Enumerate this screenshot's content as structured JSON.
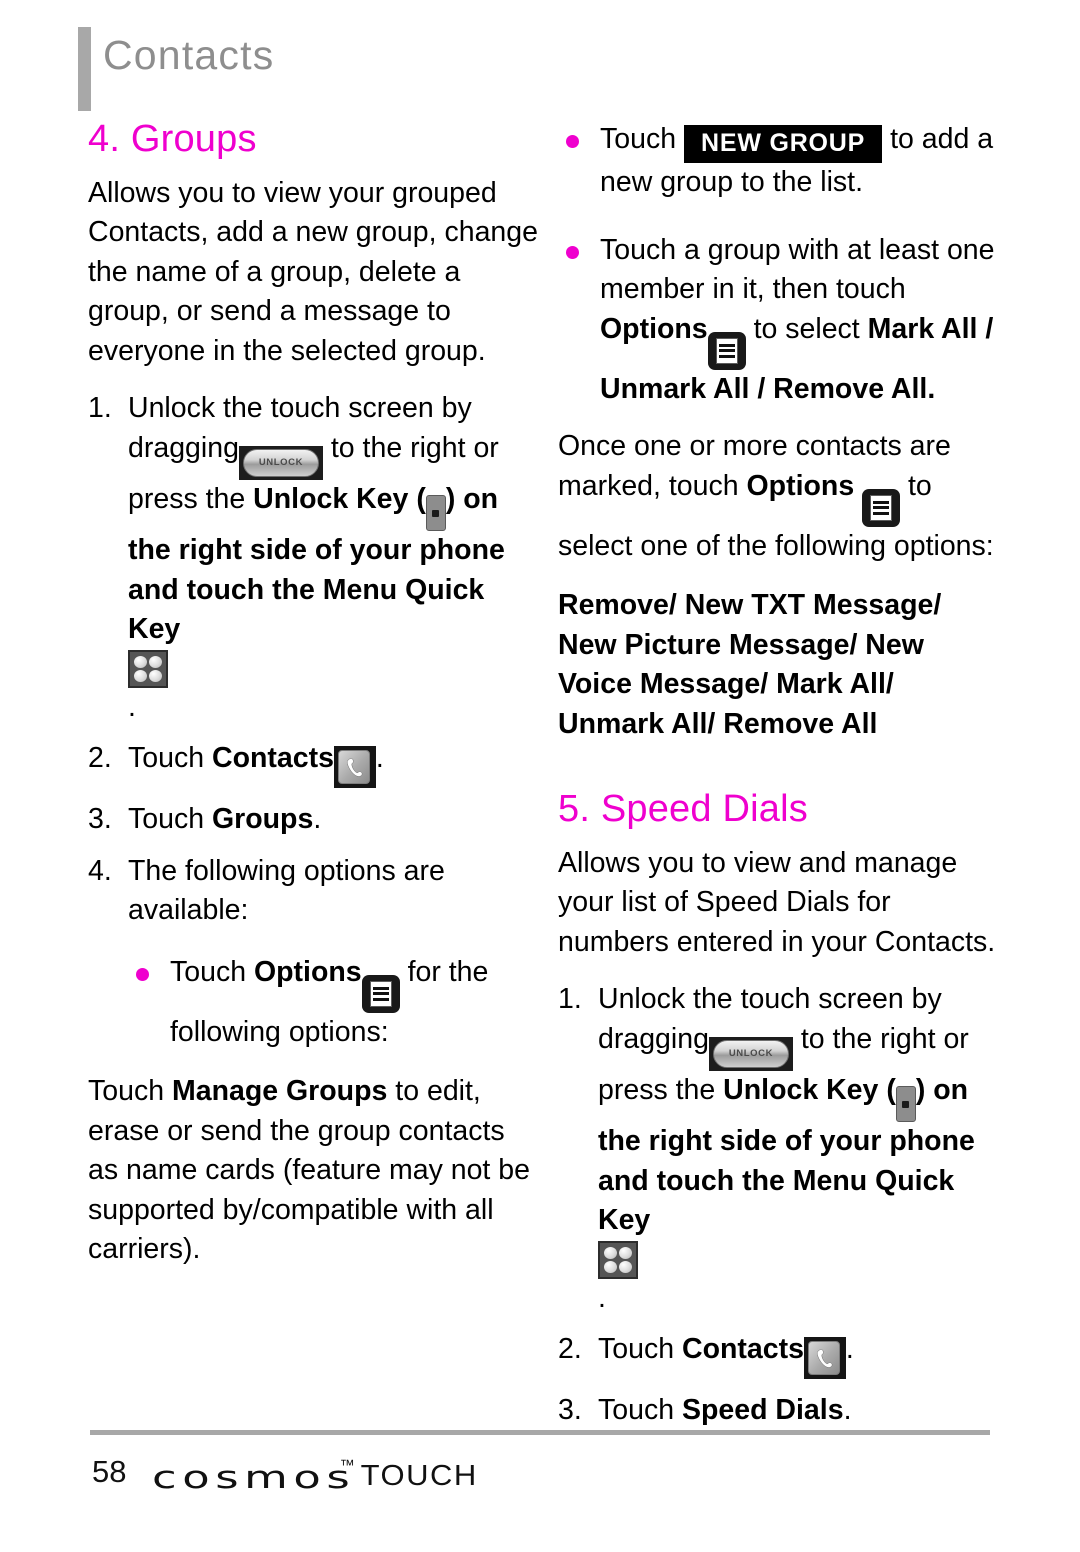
{
  "header": {
    "title": "Contacts"
  },
  "left_column": {
    "heading": "4. Groups",
    "intro": "Allows you to view your grouped Contacts, add a new group, change the name of a group, delete a group, or send a message to everyone in the selected group.",
    "steps": [
      {
        "num": "1.",
        "text_1": "Unlock the touch screen by dragging",
        "icon_1": "unlock-slider-icon",
        "text_2": "to the right or press the",
        "bold_1": "Unlock Key",
        "paren_open": "(",
        "icon_2": "side-unlock-key-icon",
        "paren_close": ")",
        "text_3": "on the right side of your phone and touch the",
        "bold_2": "Menu Quick Key",
        "icon_3": "menu-quick-key-icon",
        "text_4": "."
      },
      {
        "num": "2.",
        "text_1": "Touch",
        "bold_1": "Contacts",
        "icon_1": "contacts-icon",
        "text_2": "."
      },
      {
        "num": "3.",
        "text_1": "Touch",
        "bold_1": "Groups",
        "text_2": "."
      },
      {
        "num": "4.",
        "text_1": "The following options are available:"
      }
    ],
    "bullet_options": {
      "text_1": "Touch",
      "bold_1": "Options",
      "icon_1": "options-icon",
      "text_2": "for the following options:"
    },
    "manage_groups": {
      "text_1": "Touch",
      "bold_1": "Manage Groups",
      "text_2": "to edit, erase or send the group contacts as name cards (feature may not be supported by/compatible with all carriers)."
    }
  },
  "right_column": {
    "bullet_new_group": {
      "text_1": "Touch",
      "button_label": "NEW GROUP",
      "text_2": "to add a new group to the list."
    },
    "bullet_mark": {
      "text_1": "Touch a group with at least one member in it, then touch",
      "bold_1": "Options",
      "icon_1": "options-icon",
      "text_2": "to select",
      "bold_2": "Mark All / Unmark All / Remove All",
      "text_3": "."
    },
    "once_marked": {
      "text_1": "Once one or more contacts are marked, touch",
      "bold_1": "Options",
      "icon_1": "options-icon",
      "text_2": "to select one of the following options:"
    },
    "options_list": "Remove/ New TXT Message/ New Picture Message/ New Voice Message/ Mark All/ Unmark All/ Remove All",
    "heading": "5. Speed Dials",
    "intro": "Allows you to view and manage your list of Speed Dials for numbers entered in your Contacts.",
    "steps": [
      {
        "num": "1.",
        "text_1": "Unlock the touch screen by dragging",
        "icon_1": "unlock-slider-icon",
        "text_2": "to the right or press the",
        "bold_1": "Unlock Key",
        "paren_open": "(",
        "icon_2": "side-unlock-key-icon",
        "paren_close": ")",
        "text_3": "on the right side of your phone and touch the",
        "bold_2": "Menu Quick Key",
        "icon_3": "menu-quick-key-icon",
        "text_4": "."
      },
      {
        "num": "2.",
        "text_1": "Touch",
        "bold_1": "Contacts",
        "icon_1": "contacts-icon",
        "text_2": "."
      },
      {
        "num": "3.",
        "text_1": "Touch",
        "bold_1": "Speed Dials",
        "text_2": "."
      }
    ]
  },
  "footer": {
    "page_number": "58",
    "brand": "cosmos",
    "trademark": "™",
    "product": "TOUCH"
  },
  "icons": {
    "unlock_slider_label": "UNLOCK"
  },
  "colors": {
    "accent_magenta": "#ef00ce",
    "header_grey": "#8e8e8e",
    "rule_grey": "#a8a8a8"
  }
}
